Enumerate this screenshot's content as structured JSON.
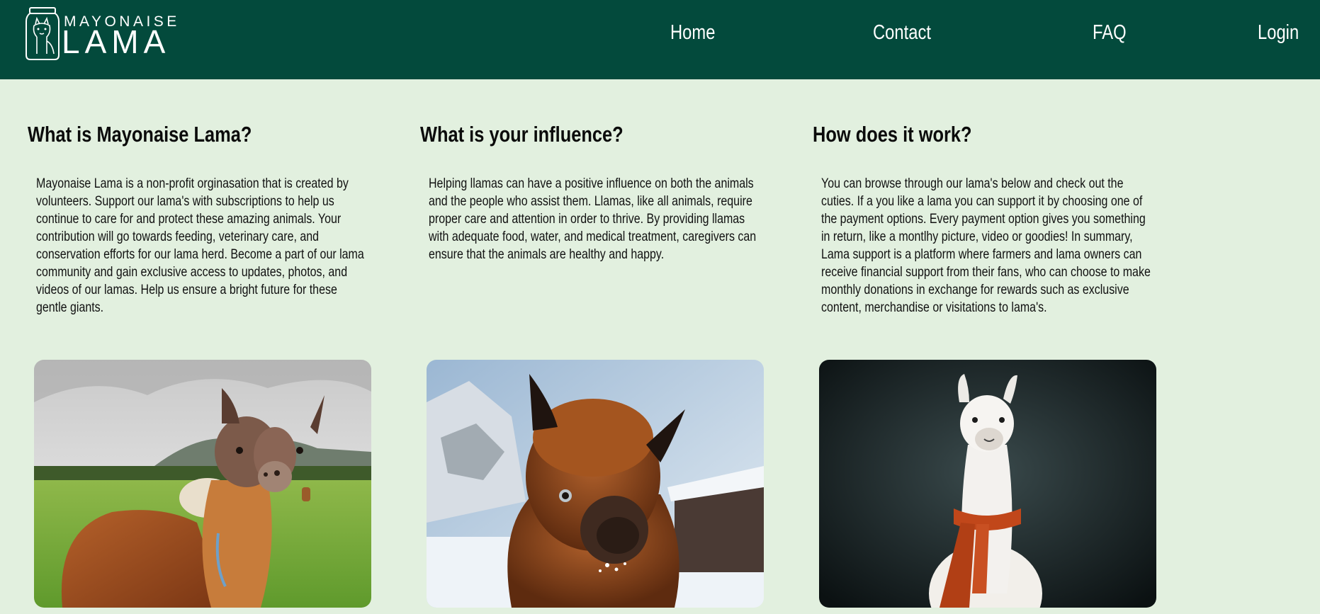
{
  "header": {
    "logo": {
      "top_text": "MAYONAISE",
      "main_text": "LAMA"
    },
    "nav": [
      {
        "label": "Home"
      },
      {
        "label": "Contact"
      },
      {
        "label": "FAQ"
      },
      {
        "label": "Login"
      }
    ]
  },
  "columns": [
    {
      "title": "What is Mayonaise Lama?",
      "text": "Mayonaise Lama is a non-profit orginasation that is created by volunteers. Support our lama's with subscriptions to help us continue to care for and protect these amazing animals. Your contribution will go towards feeding, veterinary care, and conservation efforts for our lama herd. Become a part of our lama community and gain exclusive access to updates, photos, and videos of our lamas. Help us ensure a bright future for these gentle giants.",
      "image": "llama-in-green-field-photo"
    },
    {
      "title": "What is your influence?",
      "text": "Helping llamas can have a positive influence on both the animals and the people who assist them. Llamas, like all animals, require proper care and attention in order to thrive. By providing llamas with adequate food, water, and medical treatment, caregivers can ensure that the animals are healthy and happy.",
      "image": "alpaca-in-snow-photo"
    },
    {
      "title": "How does it work?",
      "text": "You can browse through our lama's below and check out the cuties. If a you like a lama you can support it by choosing one of the payment options. Every payment option gives you something in return, like a montlhy picture, video or goodies! In summary, Lama support is a platform where farmers and lama owners can receive financial support from their fans, who can choose to make monthly donations in exchange for rewards such as exclusive content, merchandise or visitations to lama's.",
      "image": "white-llama-with-scarf-photo"
    }
  ],
  "colors": {
    "header_bg": "#034a3c",
    "page_bg": "#e2f0df",
    "nav_text": "#ffffff",
    "body_text": "#0b0b0b"
  }
}
